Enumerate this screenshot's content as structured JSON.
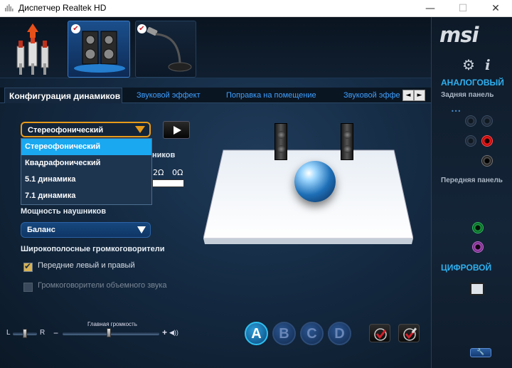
{
  "window": {
    "title": "Диспетчер Realtek HD",
    "min_glyph": "—",
    "max_glyph": "☐",
    "close_glyph": "✕"
  },
  "tabs": [
    {
      "label": "Конфигурация динамиков"
    },
    {
      "label": "Звуковой эффект"
    },
    {
      "label": "Поправка на помещение"
    },
    {
      "label": "Звуковой эффе"
    }
  ],
  "tab_arrows": {
    "left": "◄",
    "right": "►"
  },
  "speaker_config": {
    "selected": "Стереофонический",
    "options": [
      "Стереофонический",
      "Квадрафонический",
      "5.1 динамика",
      "7.1 динамика"
    ]
  },
  "headphone_fragment": {
    "label": "ников",
    "ohm_a": "2Ω",
    "ohm_b": "0Ω"
  },
  "headphone_power": {
    "label": "Мощность наушников",
    "selected": "Баланс"
  },
  "fullrange": {
    "label": "Широкополосные громкоговорители",
    "front_label": "Передние левый и правый",
    "front_checked": true,
    "surround_label": "Громкоговорители объемного звука",
    "surround_checked": false
  },
  "volume": {
    "label": "Главная громкость",
    "balance_left": "L",
    "balance_right": "R",
    "minus": "−",
    "plus": "+",
    "speaker_glyph": "◀))",
    "balance_pos": 0.5,
    "level": 0.48
  },
  "profiles": [
    "A",
    "B",
    "C",
    "D"
  ],
  "profile_active": "A",
  "right_panel": {
    "brand": "msi",
    "gear_glyph": "⚙",
    "info_glyph": "i",
    "analog_heading": "АНАЛОГОВЫЙ",
    "rear_label": "Задняя панель",
    "front_label": "Передняя панель",
    "digital_heading": "ЦИФРОВОЙ",
    "wrench_glyph": "🔧"
  },
  "colors": {
    "accent": "#2fb0f0",
    "selection": "#1aa8f0",
    "dropdown_border": "#e79a1a",
    "jack_red": "#ff2020"
  }
}
